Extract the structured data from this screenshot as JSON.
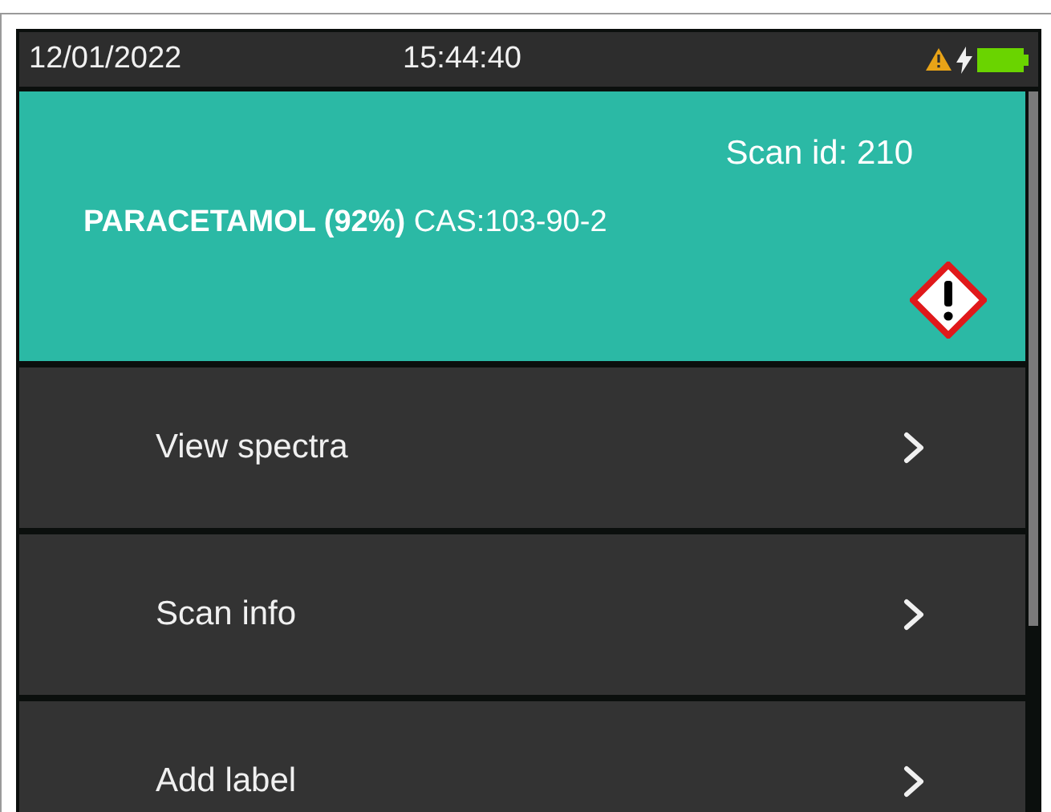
{
  "status_bar": {
    "date": "12/01/2022",
    "time": "15:44:40"
  },
  "result_card": {
    "scan_id": "Scan id: 210",
    "substance": "**PARACETAMOL (92%)** CAS:103-90-2"
  },
  "menu": [
    {
      "label": "View spectra"
    },
    {
      "label": "Scan info"
    },
    {
      "label": "Add label"
    }
  ]
}
